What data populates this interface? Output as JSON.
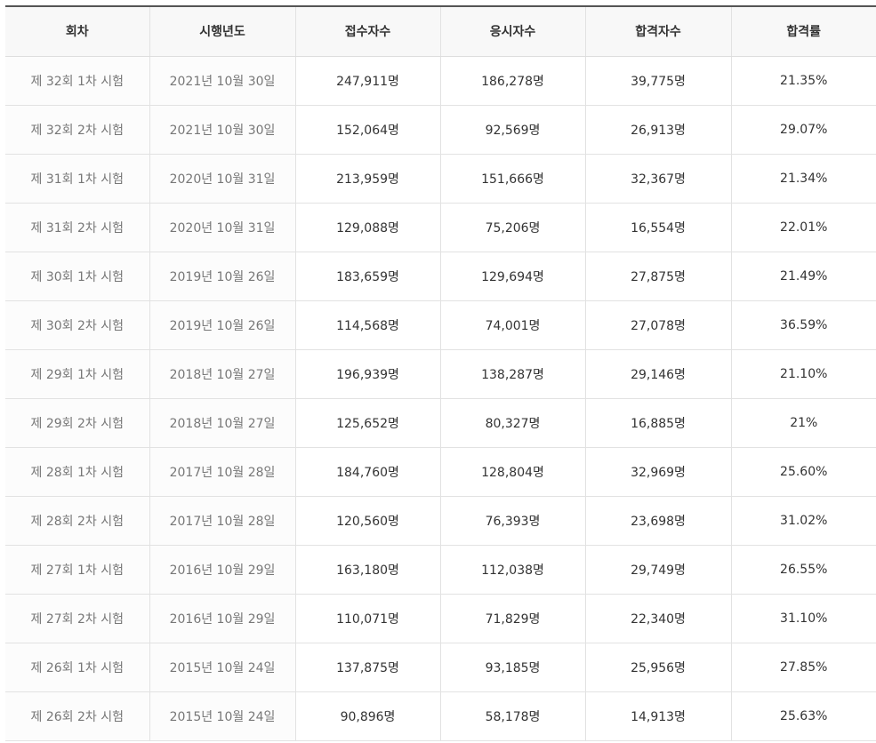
{
  "table": {
    "headers": [
      "회차",
      "시행년도",
      "접수자수",
      "응시자수",
      "합격자수",
      "합격률"
    ],
    "rows": [
      [
        "제 32회 1차 시험",
        "2021년 10월 30일",
        "247,911명",
        "186,278명",
        "39,775명",
        "21.35%"
      ],
      [
        "제 32회 2차 시험",
        "2021년 10월 30일",
        "152,064명",
        "92,569명",
        "26,913명",
        "29.07%"
      ],
      [
        "제 31회 1차 시험",
        "2020년 10월 31일",
        "213,959명",
        "151,666명",
        "32,367명",
        "21.34%"
      ],
      [
        "제 31회 2차 시험",
        "2020년 10월 31일",
        "129,088명",
        "75,206명",
        "16,554명",
        "22.01%"
      ],
      [
        "제 30회 1차 시험",
        "2019년 10월 26일",
        "183,659명",
        "129,694명",
        "27,875명",
        "21.49%"
      ],
      [
        "제 30회 2차 시험",
        "2019년 10월 26일",
        "114,568명",
        "74,001명",
        "27,078명",
        "36.59%"
      ],
      [
        "제 29회 1차 시험",
        "2018년 10월 27일",
        "196,939명",
        "138,287명",
        "29,146명",
        "21.10%"
      ],
      [
        "제 29회 2차 시험",
        "2018년 10월 27일",
        "125,652명",
        "80,327명",
        "16,885명",
        "21%"
      ],
      [
        "제 28회 1차 시험",
        "2017년 10월 28일",
        "184,760명",
        "128,804명",
        "32,969명",
        "25.60%"
      ],
      [
        "제 28회 2차 시험",
        "2017년 10월 28일",
        "120,560명",
        "76,393명",
        "23,698명",
        "31.02%"
      ],
      [
        "제 27회 1차 시험",
        "2016년 10월 29일",
        "163,180명",
        "112,038명",
        "29,749명",
        "26.55%"
      ],
      [
        "제 27회 2차 시험",
        "2016년 10월 29일",
        "110,071명",
        "71,829명",
        "22,340명",
        "31.10%"
      ],
      [
        "제 26회 1차 시험",
        "2015년 10월 24일",
        "137,875명",
        "93,185명",
        "25,956명",
        "27.85%"
      ],
      [
        "제 26회 2차 시험",
        "2015년 10월 24일",
        "90,896명",
        "58,178명",
        "14,913명",
        "25.63%"
      ]
    ]
  },
  "colors": {
    "header_bg": "#f8f8f8",
    "header_top_border": "#555555",
    "grid_line": "#e2e2e2",
    "muted_text": "#777777",
    "body_text": "#333333"
  }
}
